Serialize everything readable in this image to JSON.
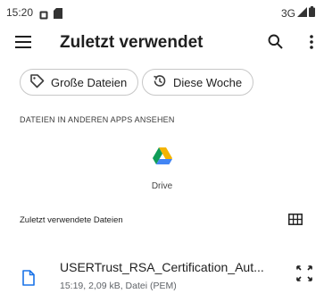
{
  "status_bar": {
    "time": "15:20",
    "network": "3G"
  },
  "app_bar": {
    "menu_icon": "hamburger-menu-icon",
    "title": "Zuletzt verwendet",
    "search_icon": "search-icon",
    "more_icon": "more-vertical-icon"
  },
  "chips": [
    {
      "label": "Große Dateien",
      "icon": "label-tag-icon"
    },
    {
      "label": "Diese Woche",
      "icon": "history-icon"
    }
  ],
  "other_apps": {
    "section_title": "DATEIEN IN ANDEREN APPS ANSEHEN",
    "apps": [
      {
        "label": "Drive",
        "icon": "google-drive-icon"
      }
    ]
  },
  "recent": {
    "header": "Zuletzt verwendete Dateien",
    "view_toggle_icon": "grid-view-icon",
    "files": [
      {
        "name": "USERTrust_RSA_Certification_Aut...",
        "meta": "15:19, 2,09 kB, Datei (PEM)",
        "icon": "file-icon",
        "expand_icon": "expand-arrows-icon"
      }
    ]
  },
  "colors": {
    "drive_green": "#0F9D58",
    "drive_blue": "#4285F4",
    "drive_yellow": "#F4B400"
  }
}
